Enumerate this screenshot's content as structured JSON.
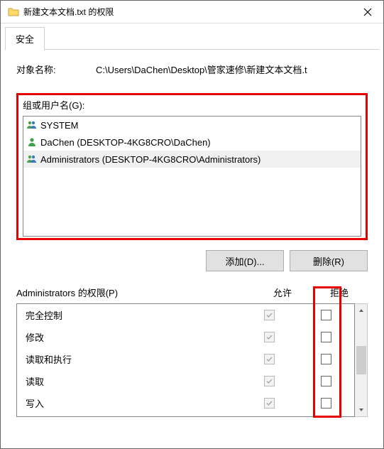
{
  "window": {
    "title": "新建文本文档.txt 的权限"
  },
  "tab": {
    "security": "安全"
  },
  "object": {
    "label": "对象名称:",
    "path": "C:\\Users\\DaChen\\Desktop\\管家速修\\新建文本文档.t"
  },
  "groups": {
    "label": "组或用户名(G):",
    "items": [
      {
        "icon": "group",
        "text": "SYSTEM"
      },
      {
        "icon": "user",
        "text": "DaChen (DESKTOP-4KG8CRO\\DaChen)"
      },
      {
        "icon": "group",
        "text": "Administrators (DESKTOP-4KG8CRO\\Administrators)"
      }
    ]
  },
  "buttons": {
    "add": "添加(D)...",
    "remove": "删除(R)"
  },
  "perm": {
    "title": "Administrators 的权限(P)",
    "allow": "允许",
    "deny": "拒绝",
    "rows": [
      {
        "name": "完全控制",
        "allow": true,
        "deny": false
      },
      {
        "name": "修改",
        "allow": true,
        "deny": false
      },
      {
        "name": "读取和执行",
        "allow": true,
        "deny": false
      },
      {
        "name": "读取",
        "allow": true,
        "deny": false
      },
      {
        "name": "写入",
        "allow": true,
        "deny": false
      }
    ]
  },
  "colors": {
    "highlight": "#e60000"
  }
}
